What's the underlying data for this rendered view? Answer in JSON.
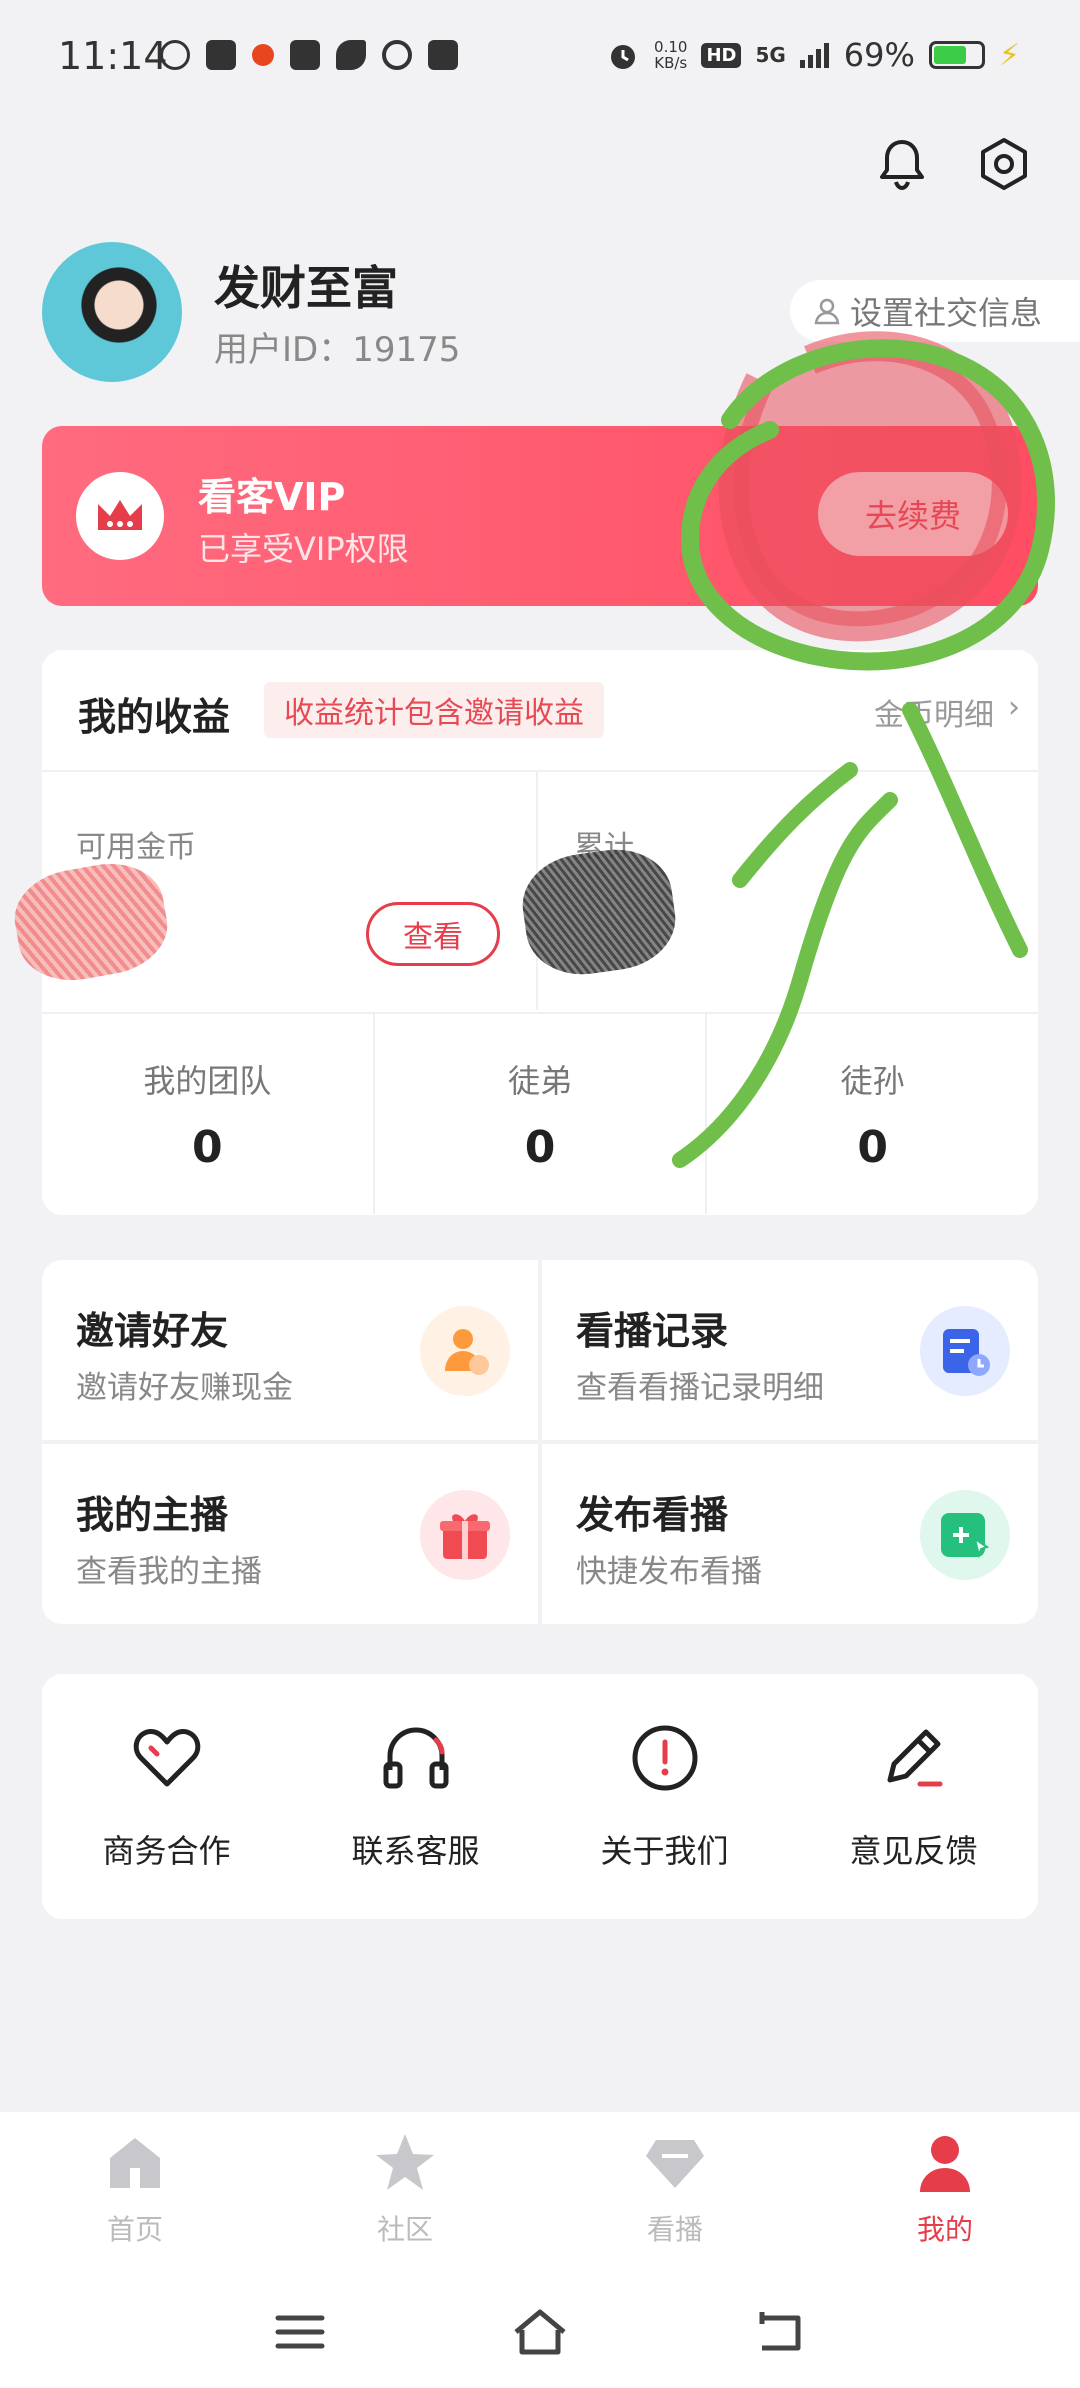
{
  "status_bar": {
    "time": "11:14",
    "net_speed": "0.10\nKB/s",
    "hd": "HD",
    "signal": "5G",
    "battery": "69%",
    "battery_level": 0.69
  },
  "profile": {
    "nickname": "发财至富",
    "user_id": "用户ID：19175",
    "social_button": "设置社交信息"
  },
  "vip": {
    "title": "看客VIP",
    "subtitle": "已享受VIP权限",
    "renew_button": "去续费"
  },
  "earnings": {
    "title": "我的收益",
    "tag": "收益统计包含邀请收益",
    "detail_link": "金币明细",
    "available_label": "可用金币",
    "total_label": "累计",
    "view_button": "查看",
    "team": [
      {
        "label": "我的团队",
        "value": "0"
      },
      {
        "label": "徒弟",
        "value": "0"
      },
      {
        "label": "徒孙",
        "value": "0"
      }
    ]
  },
  "features": [
    {
      "title": "邀请好友",
      "subtitle": "邀请好友赚现金",
      "icon": "invite-friend-icon",
      "color": "#ff9a3c"
    },
    {
      "title": "看播记录",
      "subtitle": "查看看播记录明细",
      "icon": "watch-history-icon",
      "color": "#3c64e8"
    },
    {
      "title": "我的主播",
      "subtitle": "查看我的主播",
      "icon": "gift-icon",
      "color": "#f04a52"
    },
    {
      "title": "发布看播",
      "subtitle": "快捷发布看播",
      "icon": "publish-icon",
      "color": "#26c07e"
    }
  ],
  "tools": [
    {
      "label": "商务合作",
      "icon": "heart-icon"
    },
    {
      "label": "联系客服",
      "icon": "headset-icon"
    },
    {
      "label": "关于我们",
      "icon": "info-icon"
    },
    {
      "label": "意见反馈",
      "icon": "pencil-icon"
    }
  ],
  "nav": [
    {
      "label": "首页",
      "icon": "home-icon"
    },
    {
      "label": "社区",
      "icon": "star-icon"
    },
    {
      "label": "看播",
      "icon": "diamond-icon"
    },
    {
      "label": "我的",
      "icon": "person-icon",
      "active": true
    }
  ],
  "colors": {
    "accent": "#e63d4a",
    "vip_gradient_start": "#ff6b7f",
    "vip_gradient_end": "#ff4d63",
    "annotation_green": "#6fbf4a"
  }
}
